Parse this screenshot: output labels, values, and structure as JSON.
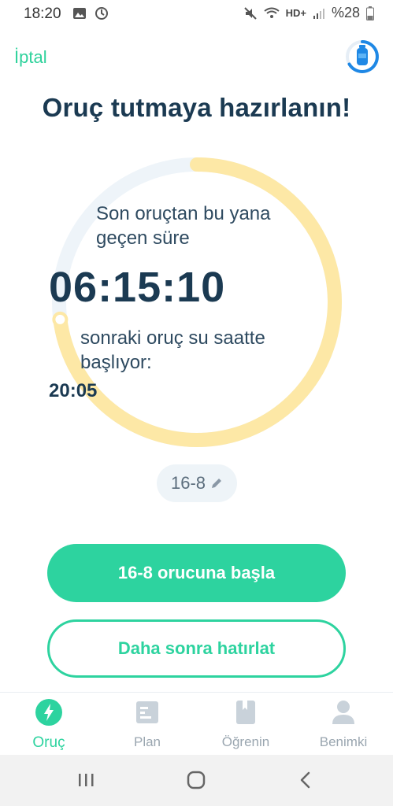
{
  "status_bar": {
    "time": "18:20",
    "network": "HD+",
    "battery": "%28",
    "icons": [
      "image-icon",
      "sync-icon",
      "mute-icon",
      "wifi-icon",
      "signal-icon",
      "battery-icon"
    ]
  },
  "header": {
    "cancel": "İptal",
    "water_icon": "water-bottle-icon",
    "title": "Oruç tutmaya hazırlanın!"
  },
  "timer": {
    "label": "Son oruçtan bu yana geçen süre",
    "elapsed": "06:15:10",
    "next_label": "sonraki oruç su saatte başlıyor:",
    "next_time": "20:05",
    "progress": 0.73,
    "colors": {
      "track": "#eef4f9",
      "progress": "#fde8a6"
    }
  },
  "plan_chip": {
    "label": "16-8",
    "icon": "pencil-icon"
  },
  "actions": {
    "start": "16-8 orucuna başla",
    "remind": "Daha sonra hatırlat"
  },
  "colors": {
    "accent": "#2dd39f",
    "title": "#1b3a52"
  },
  "nav": {
    "items": [
      {
        "label": "Oruç",
        "icon": "lightning-icon",
        "active": true
      },
      {
        "label": "Plan",
        "icon": "plan-icon",
        "active": false
      },
      {
        "label": "Öğrenin",
        "icon": "book-icon",
        "active": false
      },
      {
        "label": "Benimki",
        "icon": "profile-icon",
        "active": false
      }
    ]
  },
  "system_nav": {
    "icons": [
      "recents-icon",
      "home-icon",
      "back-icon"
    ]
  }
}
